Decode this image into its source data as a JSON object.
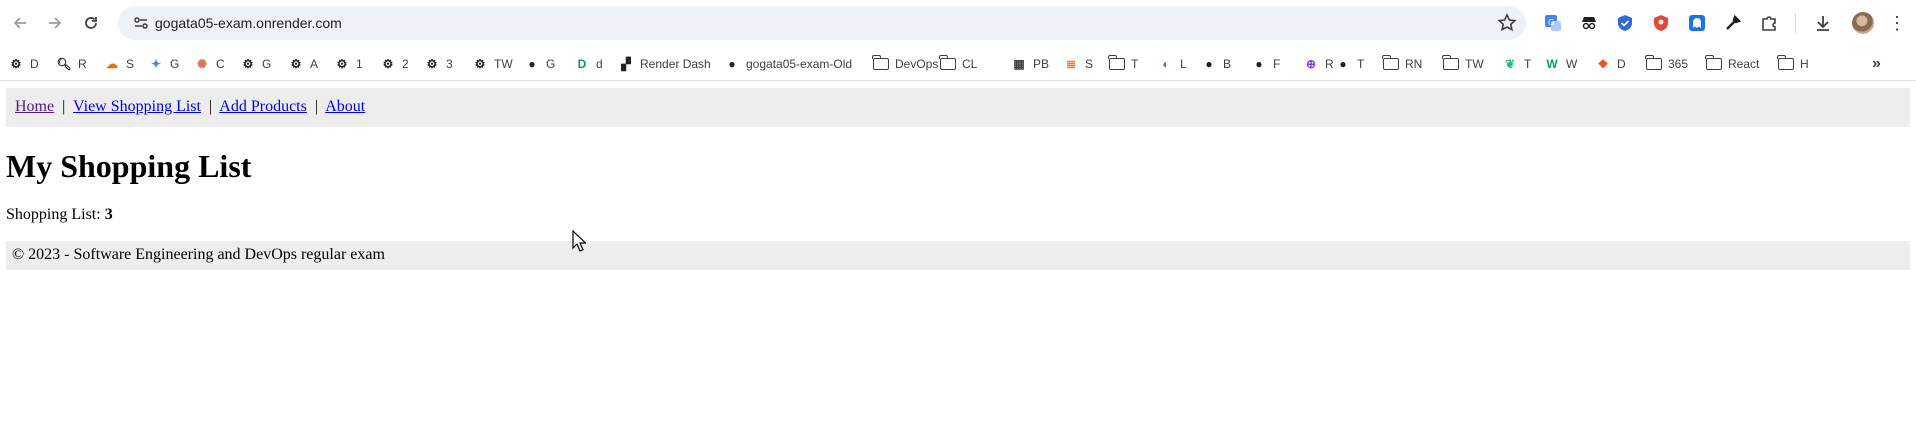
{
  "browser": {
    "url": "gogata05-exam.onrender.com",
    "bookmarks": [
      {
        "label": "D",
        "icon": "openai-icon"
      },
      {
        "label": "R",
        "icon": "search-icon"
      },
      {
        "label": "S",
        "icon": "cloud-icon"
      },
      {
        "label": "G",
        "icon": "gemini-icon"
      },
      {
        "label": "C",
        "icon": "claude-icon"
      },
      {
        "label": "G",
        "icon": "openai-icon"
      },
      {
        "label": "A",
        "icon": "openai-icon"
      },
      {
        "label": "1",
        "icon": "openai-icon"
      },
      {
        "label": "2",
        "icon": "openai-icon"
      },
      {
        "label": "3",
        "icon": "openai-icon"
      },
      {
        "label": "TW",
        "icon": "openai-icon"
      },
      {
        "label": "G",
        "icon": "github-icon"
      },
      {
        "label": "d",
        "icon": "d-icon"
      },
      {
        "label": "Render Dash",
        "icon": "render-icon"
      },
      {
        "label": "gogata05-exam-Old",
        "icon": "github-icon"
      },
      {
        "label": "DevOps",
        "icon": "folder-icon"
      },
      {
        "label": "CL",
        "icon": "folder-icon"
      },
      {
        "label": "PB",
        "icon": "grid-icon"
      },
      {
        "label": "S",
        "icon": "stackoverflow-icon"
      },
      {
        "label": "T",
        "icon": "folder-icon"
      },
      {
        "label": "L",
        "icon": "linear-icon"
      },
      {
        "label": "B",
        "icon": "github-icon"
      },
      {
        "label": "F",
        "icon": "github-icon"
      },
      {
        "label": "R",
        "icon": "r-icon"
      },
      {
        "label": "T",
        "icon": "github-icon"
      },
      {
        "label": "RN",
        "icon": "folder-icon"
      },
      {
        "label": "TW",
        "icon": "folder-icon"
      },
      {
        "label": "T",
        "icon": "leaf-icon"
      },
      {
        "label": "W",
        "icon": "w-icon"
      },
      {
        "label": "D",
        "icon": "figma-icon"
      },
      {
        "label": "365",
        "icon": "folder-icon"
      },
      {
        "label": "React",
        "icon": "folder-icon"
      },
      {
        "label": "H",
        "icon": "folder-icon"
      }
    ]
  },
  "nav": {
    "home": "Home",
    "separator": "|",
    "view_list": "View Shopping List",
    "add_products": "Add Products",
    "about": "About"
  },
  "main": {
    "title": "My Shopping List",
    "count_label": "Shopping List: ",
    "count_value": "3"
  },
  "footer": {
    "text": "© 2023 - Software Engineering and DevOps regular exam"
  },
  "colors": {
    "link": "#0000ee",
    "visited_link": "#551a8b",
    "bar_bg": "#ededed",
    "omnibox_bg": "#eef1f8"
  }
}
